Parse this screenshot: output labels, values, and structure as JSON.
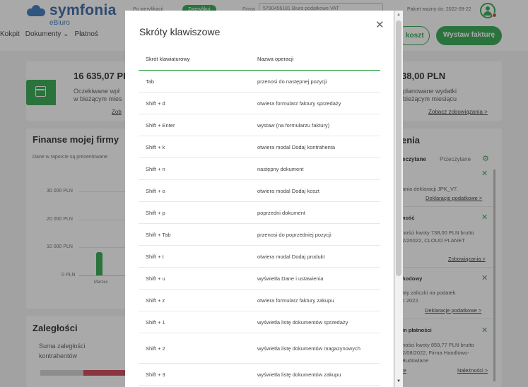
{
  "app": {
    "brand": "symfonia",
    "sub": "eBiuro",
    "top_label_1": "Po weryfikacji",
    "top_badge": "Zweryfikuj",
    "top_label_2": "Firma",
    "company_select": "5790456181 Biuro podatkowe VAT",
    "package": "Pakiet ważny do: 2022-09-22",
    "nav": [
      "Kokpit",
      "Dokumenty ⌄",
      "Płatnoś"
    ],
    "btn_koszt": "koszt",
    "btn_faktura": "Wystaw fakturę"
  },
  "dashboard": {
    "kpi1_value": "16 635,07 PL",
    "kpi1_desc1": "Oczekiwane wpł",
    "kpi1_desc2": "w bieżącym mies",
    "kpi1_link": "Zob",
    "kpi2_value": "38,00 PLN",
    "kpi2_desc1": "planowane wydatki",
    "kpi2_desc2": "bieżącym miesiącu",
    "kpi2_link": "Zobacz zobowiązania >",
    "finance_title": "Finanse mojej firmy",
    "finance_note": "Dane w raporcie są prezentowane",
    "axis": [
      "30 000 PLN",
      "20 000 PLN",
      "10 000 PLN",
      "0 PLN"
    ],
    "bar_month": "Marzec",
    "arrears_title": "Zaległości",
    "arrears_text1": "Suma zaległości",
    "arrears_text2": "kontrahentów",
    "notif_title": "enia",
    "tab_unread": "eczytane",
    "tab_read": "Przeczytane",
    "notif1_text": "ania deklaracji JPK_V7.",
    "notif1_link": "Deklaracje podatkowe >",
    "notif2_title": "ność",
    "notif2_text1": "ności kwoty 738,00 PLN brutto",
    "notif2_text2": "2/20022, CLOUD PLANET",
    "notif2_link": "Zobowiązania >",
    "notif3_title": "hodowy",
    "notif3_text1": "aty zaliczki na podatek",
    "notif3_text2": "c 2022.",
    "notif3_link": "Deklaracje podatkowe >",
    "notif4_title": "in płatności",
    "notif4_text1": "ności kwoty 859,77 PLN brutto",
    "notif4_text2": "2/08/2022, Firma Handlowo-",
    "notif4_text3": "Budowlane",
    "notif4_link": "Należności >",
    "notif4_link_left": "ie"
  },
  "modal": {
    "title": "Skróty klawiszowe",
    "col_shortcut": "Skrót klawiaturowy",
    "col_operation": "Nazwa operacji",
    "rows": [
      {
        "key": "Tab",
        "op": "przenosi do następnej pozycji"
      },
      {
        "key": "Shift + d",
        "op": "otwiera formularz faktury sprzedaży"
      },
      {
        "key": "Shift + Enter",
        "op": "wystaw (na formularzu faktury)"
      },
      {
        "key": "Shift + k",
        "op": "otwiera modal Dodaj kontrahenta"
      },
      {
        "key": "Shift + n",
        "op": "następny dokument"
      },
      {
        "key": "Shift + o",
        "op": "otwiera modal Dodaj koszt"
      },
      {
        "key": "Shift + p",
        "op": "poprzedni dokument"
      },
      {
        "key": "Shift + Tab",
        "op": "przenosi do poprzedniej pozycji"
      },
      {
        "key": "Shift + t",
        "op": "otwiera modal Dodaj produkt"
      },
      {
        "key": "Shift + u",
        "op": "wyświetla Dane i ustawienia"
      },
      {
        "key": "Shift + z",
        "op": "otwiera formularz faktury zakupu"
      },
      {
        "key": "Shift + 1",
        "op": "wyświetla listę dokumentów sprzedaży"
      },
      {
        "key": "Shift + 2",
        "op": "wyświetla listę dokumentów magazynowych"
      },
      {
        "key": "Shift + 3",
        "op": "wyświetla listę dokumentów zakupu"
      }
    ]
  }
}
